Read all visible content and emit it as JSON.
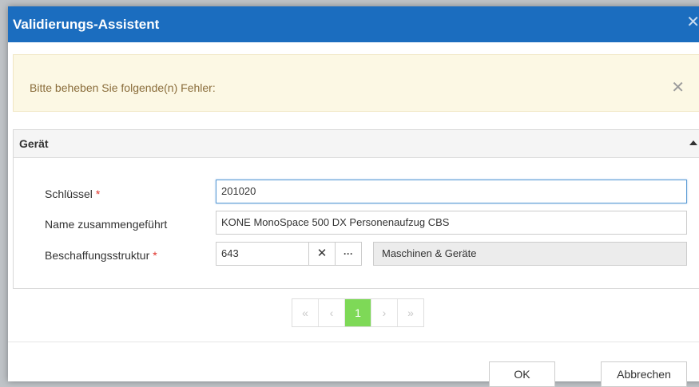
{
  "dialog": {
    "title": "Validierungs-Assistent",
    "close_symbol": "✕"
  },
  "alert": {
    "message": "Bitte beheben Sie folgende(n) Fehler:",
    "close_symbol": "✕",
    "background": "#fcf8e4",
    "text_color": "#8a6d3b"
  },
  "panel": {
    "title": "Gerät",
    "toggle_icon": "caret-up-icon"
  },
  "fields": {
    "key": {
      "label": "Schlüssel",
      "required": "*",
      "value": "201020"
    },
    "name": {
      "label": "Name zusammengeführt",
      "value": "KONE MonoSpace 500 DX Personenaufzug CBS"
    },
    "procurement": {
      "label": "Beschaffungsstruktur",
      "required": "*",
      "value": "643",
      "clear_symbol": "✕",
      "more_symbol": "···",
      "description": "Maschinen & Geräte"
    }
  },
  "pagination": {
    "first": "«",
    "prev": "‹",
    "current": "1",
    "next": "›",
    "last": "»",
    "active_color": "#7ed957"
  },
  "footer": {
    "ok_label": "OK",
    "cancel_label": "Abbrechen"
  },
  "colors": {
    "titlebar": "#1b6dbf",
    "required": "#e0332b"
  }
}
